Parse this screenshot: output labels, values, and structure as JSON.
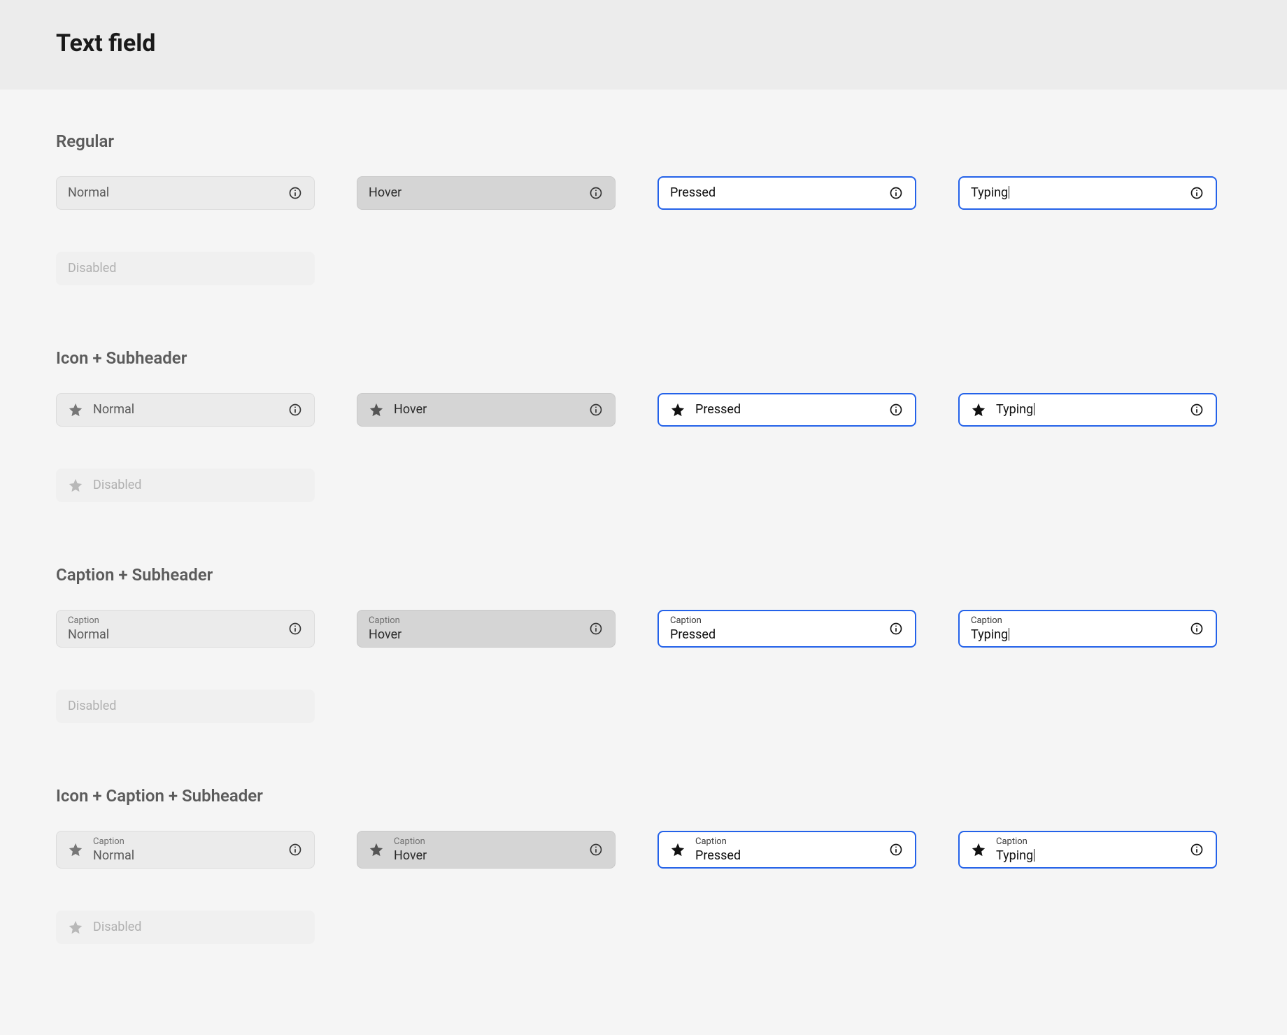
{
  "page_title": "Text field",
  "sections": [
    {
      "title": "Regular",
      "rows": [
        [
          {
            "state": "normal",
            "value": "Normal",
            "left_icon": false,
            "caption": null,
            "info_icon": true,
            "cursor": false
          },
          {
            "state": "hover",
            "value": "Hover",
            "left_icon": false,
            "caption": null,
            "info_icon": true,
            "cursor": false
          },
          {
            "state": "pressed",
            "value": "Pressed",
            "left_icon": false,
            "caption": null,
            "info_icon": true,
            "cursor": false
          },
          {
            "state": "typing",
            "value": "Typing",
            "left_icon": false,
            "caption": null,
            "info_icon": true,
            "cursor": true
          }
        ],
        [
          {
            "state": "disabled",
            "value": "Disabled",
            "left_icon": false,
            "caption": null,
            "info_icon": false,
            "cursor": false
          }
        ]
      ]
    },
    {
      "title": "Icon + Subheader",
      "rows": [
        [
          {
            "state": "normal",
            "value": "Normal",
            "left_icon": true,
            "caption": null,
            "info_icon": true,
            "cursor": false
          },
          {
            "state": "hover",
            "value": "Hover",
            "left_icon": true,
            "caption": null,
            "info_icon": true,
            "cursor": false
          },
          {
            "state": "pressed",
            "value": "Pressed",
            "left_icon": true,
            "caption": null,
            "info_icon": true,
            "cursor": false
          },
          {
            "state": "typing",
            "value": "Typing",
            "left_icon": true,
            "caption": null,
            "info_icon": true,
            "cursor": true
          }
        ],
        [
          {
            "state": "disabled",
            "value": "Disabled",
            "left_icon": true,
            "caption": null,
            "info_icon": false,
            "cursor": false
          }
        ]
      ]
    },
    {
      "title": "Caption + Subheader",
      "rows": [
        [
          {
            "state": "normal",
            "value": "Normal",
            "left_icon": false,
            "caption": "Caption",
            "info_icon": true,
            "cursor": false
          },
          {
            "state": "hover",
            "value": "Hover",
            "left_icon": false,
            "caption": "Caption",
            "info_icon": true,
            "cursor": false
          },
          {
            "state": "pressed",
            "value": "Pressed",
            "left_icon": false,
            "caption": "Caption",
            "info_icon": true,
            "cursor": false
          },
          {
            "state": "typing",
            "value": "Typing",
            "left_icon": false,
            "caption": "Caption",
            "info_icon": true,
            "cursor": true
          }
        ],
        [
          {
            "state": "disabled",
            "value": "Disabled",
            "left_icon": false,
            "caption": null,
            "info_icon": false,
            "cursor": false
          }
        ]
      ]
    },
    {
      "title": "Icon + Caption + Subheader",
      "rows": [
        [
          {
            "state": "normal",
            "value": "Normal",
            "left_icon": true,
            "caption": "Caption",
            "info_icon": true,
            "cursor": false
          },
          {
            "state": "hover",
            "value": "Hover",
            "left_icon": true,
            "caption": "Caption",
            "info_icon": true,
            "cursor": false
          },
          {
            "state": "pressed",
            "value": "Pressed",
            "left_icon": true,
            "caption": "Caption",
            "info_icon": true,
            "cursor": false
          },
          {
            "state": "typing",
            "value": "Typing",
            "left_icon": true,
            "caption": "Caption",
            "info_icon": true,
            "cursor": true
          }
        ],
        [
          {
            "state": "disabled",
            "value": "Disabled",
            "left_icon": true,
            "caption": null,
            "info_icon": false,
            "cursor": false
          }
        ]
      ]
    }
  ]
}
